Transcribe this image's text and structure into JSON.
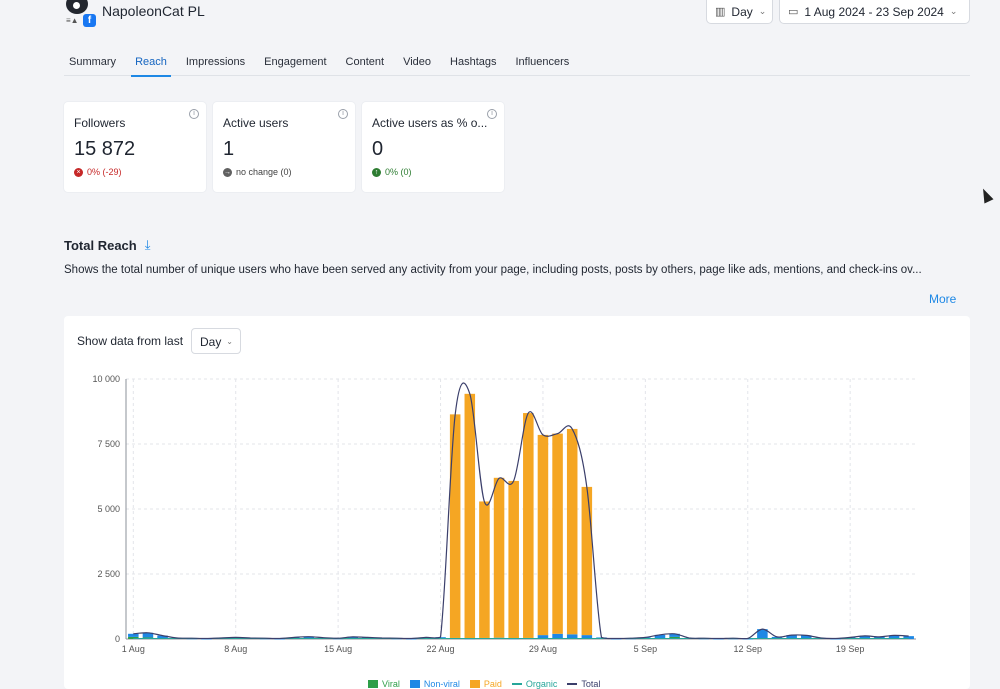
{
  "profile": {
    "name": "NapoleonCat PL",
    "avatar_tag": "≡▲",
    "fb_letter": "f"
  },
  "header": {
    "granularity": "Day",
    "date_range": "1 Aug 2024 - 23 Sep 2024"
  },
  "tabs": [
    {
      "label": "Summary"
    },
    {
      "label": "Reach"
    },
    {
      "label": "Impressions"
    },
    {
      "label": "Engagement"
    },
    {
      "label": "Content"
    },
    {
      "label": "Video"
    },
    {
      "label": "Hashtags"
    },
    {
      "label": "Influencers"
    }
  ],
  "active_tab": "Reach",
  "cards": [
    {
      "title": "Followers",
      "value": "15 872",
      "change": "0% (-29)",
      "change_color": "#c62828",
      "change_icon": "×"
    },
    {
      "title": "Active users",
      "value": "1",
      "change": "no change (0)",
      "change_color": "#616161",
      "change_icon": "→"
    },
    {
      "title": "Active users as % o...",
      "value": "0",
      "change": "0% (0)",
      "change_color": "#2e7d32",
      "change_icon": "↑"
    }
  ],
  "section": {
    "title": "Total Reach",
    "description": "Shows the total number of unique users who have been served any activity from your page, including posts, posts by others, page like ads, mentions, and check-ins ov...",
    "more": "More"
  },
  "filter": {
    "label": "Show data from last",
    "value": "Day"
  },
  "colors": {
    "viral": "#2e9e48",
    "nonviral": "#1e88e5",
    "paid": "#f5a623",
    "organic": "#26a69a",
    "total": "#3b3f6b",
    "accent": "#1e88e5"
  },
  "chart_data": {
    "type": "bar",
    "yticks": [
      "10 000",
      "7 500",
      "5 000",
      "2 500",
      "0"
    ],
    "ylim": [
      0,
      10000
    ],
    "xticks": [
      {
        "label": "1 Aug",
        "index": 0
      },
      {
        "label": "8 Aug",
        "index": 7
      },
      {
        "label": "15 Aug",
        "index": 14
      },
      {
        "label": "22 Aug",
        "index": 21
      },
      {
        "label": "29 Aug",
        "index": 28
      },
      {
        "label": "5 Sep",
        "index": 35
      },
      {
        "label": "12 Sep",
        "index": 42
      },
      {
        "label": "19 Sep",
        "index": 49
      }
    ],
    "days": 54,
    "series": [
      {
        "name": "Viral",
        "values": [
          80,
          60,
          0,
          0,
          0,
          0,
          0,
          0,
          0,
          0,
          0,
          0,
          0,
          0,
          0,
          0,
          0,
          0,
          0,
          0,
          0,
          0,
          0,
          0,
          0,
          0,
          0,
          0,
          0,
          0,
          0,
          0,
          0,
          0,
          0,
          0,
          0,
          80,
          0,
          0,
          0,
          0,
          0,
          0,
          0,
          0,
          0,
          0,
          0,
          0,
          0,
          0,
          0,
          0
        ]
      },
      {
        "name": "Non-viral",
        "values": [
          120,
          180,
          130,
          40,
          30,
          20,
          40,
          60,
          40,
          30,
          20,
          60,
          90,
          50,
          30,
          80,
          60,
          40,
          30,
          20,
          60,
          70,
          40,
          30,
          40,
          50,
          30,
          40,
          150,
          200,
          180,
          150,
          60,
          20,
          30,
          60,
          160,
          120,
          40,
          30,
          20,
          30,
          20,
          380,
          80,
          150,
          140,
          40,
          20,
          60,
          120,
          80,
          140,
          110
        ]
      },
      {
        "name": "Paid",
        "values": [
          0,
          0,
          0,
          0,
          0,
          0,
          0,
          0,
          0,
          0,
          0,
          0,
          0,
          0,
          0,
          0,
          0,
          0,
          0,
          0,
          0,
          0,
          8600,
          9400,
          5250,
          6150,
          6050,
          8650,
          7700,
          7700,
          7900,
          5700,
          0,
          0,
          0,
          0,
          0,
          0,
          0,
          0,
          0,
          0,
          0,
          0,
          0,
          0,
          0,
          0,
          0,
          0,
          0,
          0,
          0,
          0
        ]
      },
      {
        "name": "Organic",
        "values": [
          0,
          0,
          0,
          0,
          0,
          0,
          0,
          0,
          0,
          0,
          0,
          0,
          0,
          0,
          0,
          0,
          0,
          0,
          0,
          0,
          0,
          0,
          0,
          0,
          0,
          0,
          0,
          0,
          0,
          0,
          0,
          0,
          0,
          0,
          0,
          0,
          0,
          0,
          0,
          0,
          0,
          0,
          0,
          0,
          0,
          0,
          0,
          0,
          0,
          0,
          0,
          0,
          0,
          0
        ]
      },
      {
        "name": "Total",
        "values": [
          200,
          240,
          130,
          40,
          30,
          20,
          40,
          60,
          40,
          30,
          20,
          60,
          90,
          50,
          30,
          80,
          60,
          40,
          30,
          20,
          60,
          70,
          8640,
          9430,
          5280,
          6180,
          6090,
          8690,
          7850,
          7900,
          8080,
          5850,
          60,
          20,
          30,
          60,
          160,
          200,
          40,
          30,
          20,
          30,
          20,
          380,
          80,
          150,
          140,
          40,
          20,
          60,
          120,
          80,
          140,
          110
        ]
      }
    ],
    "legend": [
      "Viral",
      "Non-viral",
      "Paid",
      "Organic",
      "Total"
    ],
    "legend_position": "bottom",
    "grid": true
  }
}
